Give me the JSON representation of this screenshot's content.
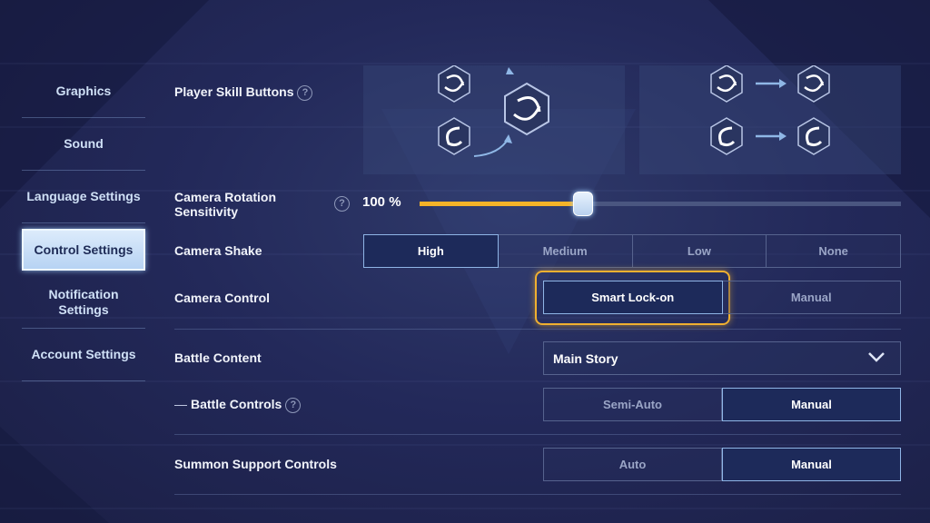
{
  "sidebar": {
    "items": [
      {
        "label": "Graphics",
        "active": false
      },
      {
        "label": "Sound",
        "active": false
      },
      {
        "label": "Language Settings",
        "active": false
      },
      {
        "label": "Control Settings",
        "active": true
      },
      {
        "label": "Notification Settings",
        "active": false
      },
      {
        "label": "Account Settings",
        "active": false
      }
    ]
  },
  "settings": {
    "player_skill_buttons": {
      "label": "Player Skill Buttons"
    },
    "camera_rotation": {
      "label_line1": "Camera Rotation",
      "label_line2": "Sensitivity",
      "value_text": "100 %",
      "value": 0.34
    },
    "camera_shake": {
      "label": "Camera Shake",
      "options": [
        "High",
        "Medium",
        "Low",
        "None"
      ],
      "selected": "High"
    },
    "camera_control": {
      "label": "Camera Control",
      "options": [
        "Smart Lock-on",
        "Manual"
      ],
      "selected": "Smart Lock-on"
    },
    "battle_content": {
      "label": "Battle Content",
      "value": "Main Story"
    },
    "battle_controls": {
      "prefix": "—",
      "label": "Battle Controls",
      "options": [
        "Semi-Auto",
        "Manual"
      ],
      "selected": "Manual"
    },
    "summon_support": {
      "label": "Summon Support Controls",
      "options": [
        "Auto",
        "Manual"
      ],
      "selected": "Manual"
    }
  },
  "colors": {
    "accent": "#f5b328",
    "highlight": "#dcebfb",
    "background": "#23295a"
  }
}
